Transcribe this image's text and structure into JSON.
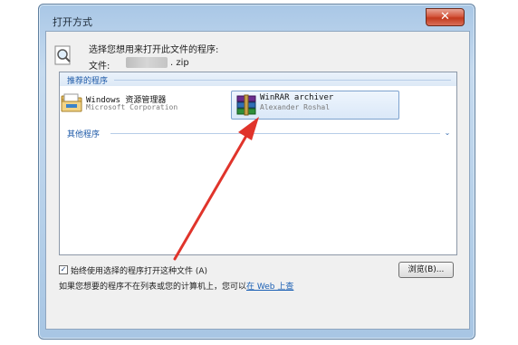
{
  "window": {
    "title": "打开方式",
    "close_glyph": "✕"
  },
  "prompt": "选择您想用来打开此文件的程序:",
  "file": {
    "label": "文件:",
    "extension": ". zip"
  },
  "recommended": {
    "header": "推荐的程序",
    "apps": [
      {
        "name": "Windows 资源管理器",
        "publisher": "Microsoft Corporation",
        "icon": "explorer-icon"
      },
      {
        "name": "WinRAR archiver",
        "publisher": "Alexander Roshal",
        "icon": "winrar-icon"
      }
    ]
  },
  "other": {
    "header": "其他程序",
    "expand_glyph": "⌄"
  },
  "always_use": {
    "label": "始终使用选择的程序打开这种文件 (A)",
    "checked_glyph": "✓"
  },
  "browse_label": "浏览(B)...",
  "bottom": {
    "text": "如果您想要的程序不在列表或您的计算机上，您可以",
    "link": "在 Web 上查"
  },
  "colors": {
    "accent": "#1e5aa8",
    "annotation_arrow": "#e0342b"
  }
}
